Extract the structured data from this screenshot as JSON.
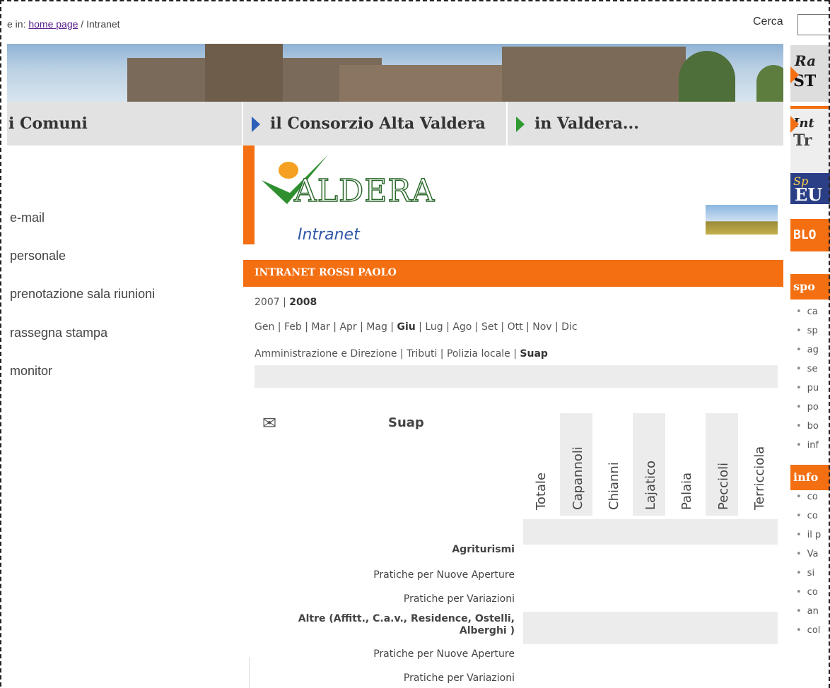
{
  "breadcrumb": {
    "prefix": "e in: ",
    "home_link": "home page",
    "current": " / Intranet"
  },
  "search": {
    "label": "Cerca",
    "value": ""
  },
  "nav": {
    "comuni": "i Comuni",
    "consorzio": "il Consorzio Alta Valdera",
    "valdera": "in Valdera..."
  },
  "left_menu": [
    "e-mail",
    "personale",
    "prenotazione sala riunioni",
    "rassegna stampa",
    "monitor"
  ],
  "logo": {
    "brand": "ALDERA",
    "sub": "Intranet"
  },
  "title_bar": "INTRANET ROSSI PAOLO",
  "years": {
    "y1": "2007",
    "sep": " | ",
    "y2": "2008"
  },
  "months": [
    {
      "label": "Gen"
    },
    {
      "label": "Feb"
    },
    {
      "label": "Mar"
    },
    {
      "label": "Apr"
    },
    {
      "label": "Mag"
    },
    {
      "label": "Giu",
      "active": true
    },
    {
      "label": "Lug"
    },
    {
      "label": "Ago"
    },
    {
      "label": "Set"
    },
    {
      "label": "Ott"
    },
    {
      "label": "Nov"
    },
    {
      "label": "Dic"
    }
  ],
  "departments": [
    {
      "label": "Amministrazione e Direzione"
    },
    {
      "label": "Tributi"
    },
    {
      "label": "Polizia locale"
    },
    {
      "label": "Suap",
      "active": true
    }
  ],
  "table": {
    "title": "Suap",
    "columns": [
      "Totale",
      "Capannoli",
      "Chianni",
      "Lajatico",
      "Palaia",
      "Peccioli",
      "Terricciola"
    ],
    "rows": [
      {
        "label": "Agriturismi",
        "bold": true
      },
      {
        "label": "Pratiche per Nuove Aperture",
        "bold": false
      },
      {
        "label": "Pratiche per Variazioni",
        "bold": false
      },
      {
        "label": "Altre (Affitt., C.a.v., Residence, Ostelli, Alberghi )",
        "bold": true
      },
      {
        "label": "Pratiche per Nuove Aperture",
        "bold": false
      },
      {
        "label": "Pratiche per Variazioni",
        "bold": false
      }
    ]
  },
  "right_col": {
    "radio": {
      "t1": "Ra",
      "t2": "ST"
    },
    "inte": {
      "t1": "Int",
      "t2": "Tr"
    },
    "eu": {
      "t1": "Sp",
      "t2": "EU"
    },
    "blog": "BLO",
    "sport_head": "spo",
    "sport_items": [
      "ca",
      "sp",
      "ag",
      "se",
      "pu",
      "po",
      "bo",
      "inf"
    ],
    "info_head": "info",
    "info_items": [
      "co",
      "co",
      "il p",
      "Va",
      "si",
      "co",
      "an",
      "col"
    ]
  }
}
